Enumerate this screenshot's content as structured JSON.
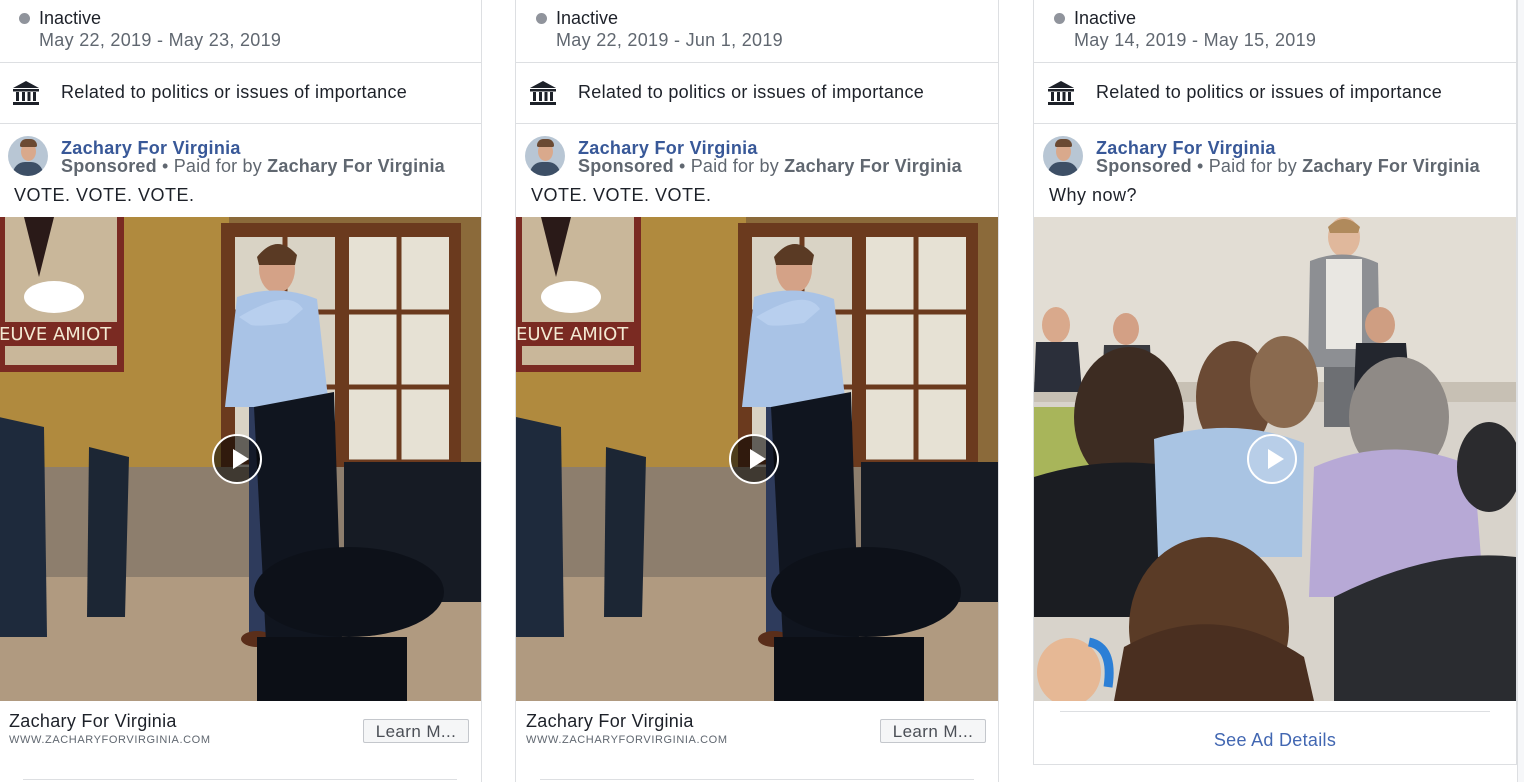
{
  "cards": [
    {
      "status": "Inactive",
      "date_range": "May 22, 2019 - May 23, 2019",
      "category": "Related to politics or issues of importance",
      "page_name": "Zachary For Virginia",
      "sponsored": "Sponsored",
      "paid_for_prefix": "• Paid for by",
      "paid_for_name": "Zachary For Virginia",
      "ad_text": "VOTE. VOTE. VOTE.",
      "link_title": "Zachary For Virginia",
      "link_url": "WWW.ZACHARYFORVIRGINIA.COM",
      "cta": "Learn M..."
    },
    {
      "status": "Inactive",
      "date_range": "May 22, 2019 - Jun 1, 2019",
      "category": "Related to politics or issues of importance",
      "page_name": "Zachary For Virginia",
      "sponsored": "Sponsored",
      "paid_for_prefix": "• Paid for by",
      "paid_for_name": "Zachary For Virginia",
      "ad_text": "VOTE. VOTE. VOTE.",
      "link_title": "Zachary For Virginia",
      "link_url": "WWW.ZACHARYFORVIRGINIA.COM",
      "cta": "Learn M..."
    },
    {
      "status": "Inactive",
      "date_range": "May 14, 2019 - May 15, 2019",
      "category": "Related to politics or issues of importance",
      "page_name": "Zachary For Virginia",
      "sponsored": "Sponsored",
      "paid_for_prefix": "• Paid for by",
      "paid_for_name": "Zachary For Virginia",
      "ad_text": "Why now?",
      "see_details": "See Ad Details"
    }
  ],
  "poster_text": "EUVE AMIOT",
  "colors": {
    "link_blue": "#385898",
    "cta_blue": "#4267b2",
    "border": "#dddfe2",
    "muted_text": "#606770"
  },
  "icons": [
    "inactive-dot-icon",
    "bank-icon",
    "play-icon"
  ]
}
